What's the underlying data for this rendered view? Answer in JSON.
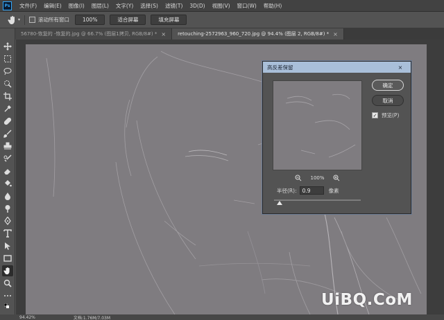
{
  "app": {
    "logo": "Ps"
  },
  "menu": [
    "文件(F)",
    "编辑(E)",
    "图像(I)",
    "图层(L)",
    "文字(Y)",
    "选择(S)",
    "滤镜(T)",
    "3D(D)",
    "视图(V)",
    "窗口(W)",
    "帮助(H)"
  ],
  "options": {
    "scroll_all_label": "滚动所有窗口",
    "zoom_button": "100%",
    "fit_screen_button": "适合屏幕",
    "fill_screen_button": "填充屏幕"
  },
  "tabs": [
    {
      "label": "56780-恢复的 -恢复的.jpg @ 66.7% (图层1拷贝, RGB/8#) *",
      "close": "×",
      "active": false
    },
    {
      "label": "retouching-2572963_960_720.jpg @ 94.4% (图层 2, RGB/8#) *",
      "close": "×",
      "active": true
    }
  ],
  "tools": [
    "move-icon",
    "marquee-icon",
    "lasso-icon",
    "quick-select-icon",
    "crop-icon",
    "eyedropper-icon",
    "healing-icon",
    "brush-icon",
    "stamp-icon",
    "history-brush-icon",
    "eraser-icon",
    "bucket-icon",
    "blur-icon",
    "dodge-icon",
    "pen-icon",
    "type-icon",
    "path-select-icon",
    "rectangle-icon",
    "hand-icon",
    "zoom-icon",
    "more-icon"
  ],
  "status": {
    "zoom": "94.42%",
    "doc": "文档:1.76M/7.03M"
  },
  "dialog": {
    "title": "高反差保留",
    "close": "×",
    "ok": "确定",
    "cancel": "取消",
    "preview_label": "预览(P)",
    "preview_checked": true,
    "zoom_level": "100%",
    "radius_label": "半径(R):",
    "radius_value": "0.9",
    "radius_unit": "像素"
  },
  "watermark": "UiBQ.CoM",
  "colors": {
    "canvas": "#7f7c80",
    "dialog_title": "#a9bfd9",
    "ui": "#535353"
  }
}
